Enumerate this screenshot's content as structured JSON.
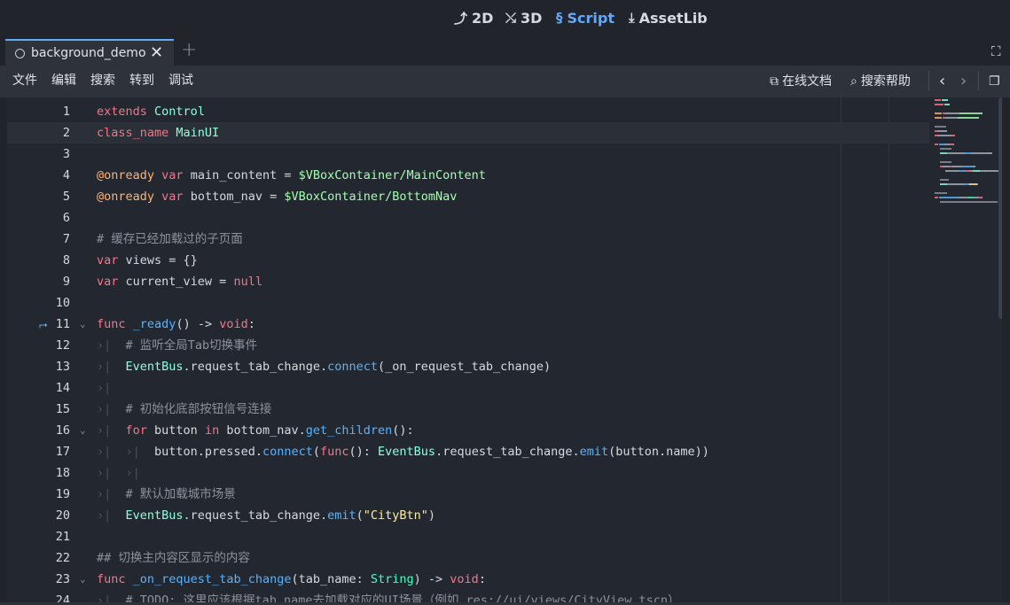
{
  "workspaces": [
    {
      "label": "2D",
      "icon": "2d-icon",
      "active": false
    },
    {
      "label": "3D",
      "icon": "3d-icon",
      "active": false
    },
    {
      "label": "Script",
      "icon": "script-icon",
      "active": true
    },
    {
      "label": "AssetLib",
      "icon": "assetlib-icon",
      "active": false
    }
  ],
  "tab": {
    "name": "background_demo",
    "close": "✕",
    "add": "+"
  },
  "menus": [
    "文件",
    "编辑",
    "搜索",
    "转到",
    "调试"
  ],
  "right_buttons": {
    "online_docs": "在线文档",
    "search_help": "搜索帮助"
  },
  "colors": {
    "accent": "#5fa9ff",
    "keyword": "#ff7085",
    "class": "#8fffdb",
    "type": "#42ffc2",
    "func": "#57b3ff",
    "string": "#ffeda1",
    "annotation": "#ffb373",
    "node_path": "#a3ffb0",
    "comment": "#8c929c"
  },
  "code_lines": [
    {
      "n": "1",
      "tokens": [
        [
          "extends",
          "k"
        ],
        [
          " ",
          ""
        ],
        [
          "Control",
          "c"
        ]
      ]
    },
    {
      "n": "2",
      "current": true,
      "tokens": [
        [
          "class_name",
          "k"
        ],
        [
          " ",
          ""
        ],
        [
          "MainUI",
          "c"
        ]
      ]
    },
    {
      "n": "3",
      "tokens": []
    },
    {
      "n": "4",
      "tokens": [
        [
          "@onready",
          "a"
        ],
        [
          " ",
          ""
        ],
        [
          "var",
          "k"
        ],
        [
          " main_content = ",
          ""
        ],
        [
          "$VBoxContainer/MainContent",
          "n"
        ]
      ]
    },
    {
      "n": "5",
      "tokens": [
        [
          "@onready",
          "a"
        ],
        [
          " ",
          ""
        ],
        [
          "var",
          "k"
        ],
        [
          " bottom_nav = ",
          ""
        ],
        [
          "$VBoxContainer/BottomNav",
          "n"
        ]
      ]
    },
    {
      "n": "6",
      "tokens": []
    },
    {
      "n": "7",
      "tokens": [
        [
          "# 缓存已经加载过的子页面",
          "cm"
        ]
      ]
    },
    {
      "n": "8",
      "tokens": [
        [
          "var",
          "k"
        ],
        [
          " views = {}",
          ""
        ]
      ]
    },
    {
      "n": "9",
      "tokens": [
        [
          "var",
          "k"
        ],
        [
          " current_view = ",
          ""
        ],
        [
          "null",
          "k"
        ]
      ]
    },
    {
      "n": "10",
      "tokens": []
    },
    {
      "n": "11",
      "fold": true,
      "breakpoint": true,
      "tokens": [
        [
          "func",
          "k"
        ],
        [
          " ",
          ""
        ],
        [
          "_ready",
          "f"
        ],
        [
          "() -> ",
          ""
        ],
        [
          "void",
          "k"
        ],
        [
          ":",
          ""
        ]
      ]
    },
    {
      "n": "12",
      "indent": 1,
      "tokens": [
        [
          "# 监听全局Tab切换事件",
          "cm"
        ]
      ]
    },
    {
      "n": "13",
      "indent": 1,
      "tokens": [
        [
          "EventBus",
          "c"
        ],
        [
          ".request_tab_change.",
          ""
        ],
        [
          "connect",
          "f"
        ],
        [
          "(_on_request_tab_change)",
          ""
        ]
      ]
    },
    {
      "n": "14",
      "indent": 1,
      "tokens": []
    },
    {
      "n": "15",
      "indent": 1,
      "tokens": [
        [
          "# 初始化底部按钮信号连接",
          "cm"
        ]
      ]
    },
    {
      "n": "16",
      "indent": 1,
      "fold": true,
      "tokens": [
        [
          "for",
          "k"
        ],
        [
          " button ",
          ""
        ],
        [
          "in",
          "k"
        ],
        [
          " bottom_nav.",
          ""
        ],
        [
          "get_children",
          "f"
        ],
        [
          "():",
          ""
        ]
      ]
    },
    {
      "n": "17",
      "indent": 2,
      "tokens": [
        [
          "button.pressed.",
          ""
        ],
        [
          "connect",
          "f"
        ],
        [
          "(",
          ""
        ],
        [
          "func",
          "k"
        ],
        [
          "(): ",
          ""
        ],
        [
          "EventBus",
          "c"
        ],
        [
          ".request_tab_change.",
          ""
        ],
        [
          "emit",
          "f"
        ],
        [
          "(button.name))",
          ""
        ]
      ]
    },
    {
      "n": "18",
      "indent": 2,
      "tokens": []
    },
    {
      "n": "19",
      "indent": 1,
      "tokens": [
        [
          "# 默认加载城市场景",
          "cm"
        ]
      ]
    },
    {
      "n": "20",
      "indent": 1,
      "tokens": [
        [
          "EventBus",
          "c"
        ],
        [
          ".request_tab_change.",
          ""
        ],
        [
          "emit",
          "f"
        ],
        [
          "(",
          ""
        ],
        [
          "\"CityBtn\"",
          "s"
        ],
        [
          ")",
          ""
        ]
      ]
    },
    {
      "n": "21",
      "tokens": []
    },
    {
      "n": "22",
      "tokens": [
        [
          "## 切换主内容区显示的内容",
          "cm"
        ]
      ]
    },
    {
      "n": "23",
      "fold": true,
      "tokens": [
        [
          "func",
          "k"
        ],
        [
          " ",
          ""
        ],
        [
          "_on_request_tab_change",
          "f"
        ],
        [
          "(tab_name: ",
          ""
        ],
        [
          "String",
          "t"
        ],
        [
          ") -> ",
          ""
        ],
        [
          "void",
          "k"
        ],
        [
          ":",
          ""
        ]
      ]
    },
    {
      "n": "24",
      "indent": 1,
      "tokens": [
        [
          "# TODO: 这里应该根据tab_name去加载对应的UI场景（例如 res://ui/views/CityView.tscn）",
          "cm"
        ]
      ]
    }
  ]
}
